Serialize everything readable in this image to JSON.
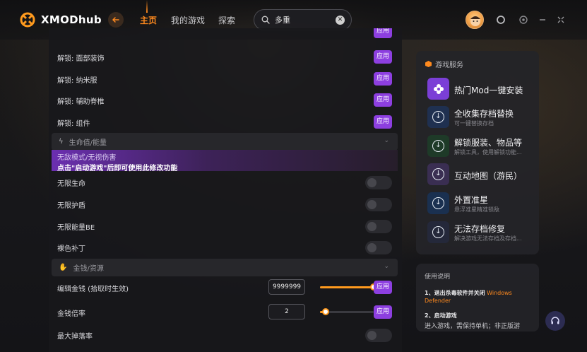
{
  "app": {
    "name": "XMODhub"
  },
  "nav": {
    "home": "主页",
    "my_games": "我的游戏",
    "explore": "探索"
  },
  "search": {
    "query": "多重",
    "icon": "search-icon"
  },
  "colors": {
    "accent": "#ff8a1e",
    "apply_purple": "#8d3fe0",
    "banner_purple": "#6b2fb0"
  },
  "list": {
    "apply_label": "应用",
    "items_top": [
      {
        "label": "解锁: 面部装饰"
      },
      {
        "label": "解锁: 纳米服"
      },
      {
        "label": "解锁: 辅助脊椎"
      },
      {
        "label": "解锁: 组件"
      }
    ],
    "section_health": {
      "title": "生命值/能量",
      "icon": "heart-pulse-icon"
    },
    "banner": {
      "line1": "无敌模式/无视伤害",
      "line2": "点击\"启动游戏\"后即可使用此修改功能"
    },
    "toggles": [
      {
        "label": "无限生命",
        "on": false
      },
      {
        "label": "无限护盾",
        "on": false
      },
      {
        "label": "无限能量BE",
        "on": false
      },
      {
        "label": "裸色补丁",
        "on": false
      }
    ],
    "section_money": {
      "title": "金钱/资源",
      "icon": "hand-coin-icon"
    },
    "money_edit": {
      "label": "编辑金钱 (拾取时生效)",
      "value": "9999999",
      "slider_fraction": 1.0
    },
    "money_mult": {
      "label": "金钱倍率",
      "value": "2",
      "slider_fraction": 0.1
    },
    "drop_rate": {
      "label": "最大掉落率",
      "on": false
    }
  },
  "services": {
    "title": "游戏服务",
    "items": [
      {
        "name": "热门Mod一键安装",
        "desc": ""
      },
      {
        "name": "全收集存档替换",
        "desc": "可一键替换存档"
      },
      {
        "name": "解锁服装、物品等",
        "desc": "解锁工具，使用解锁功能..."
      },
      {
        "name": "互动地图（游民）",
        "desc": ""
      },
      {
        "name": "外置准星",
        "desc": "悬浮准星精准锁敌"
      },
      {
        "name": "无法存档修复",
        "desc": "解决游戏无法存档及存档..."
      }
    ]
  },
  "help": {
    "title": "使用说明",
    "step1": "1、退出杀毒软件并关闭",
    "step1_highlight": "Windows Defender",
    "step2": "2、启动游戏",
    "step2_desc": "进入游戏，需保持单机；非正版游"
  }
}
